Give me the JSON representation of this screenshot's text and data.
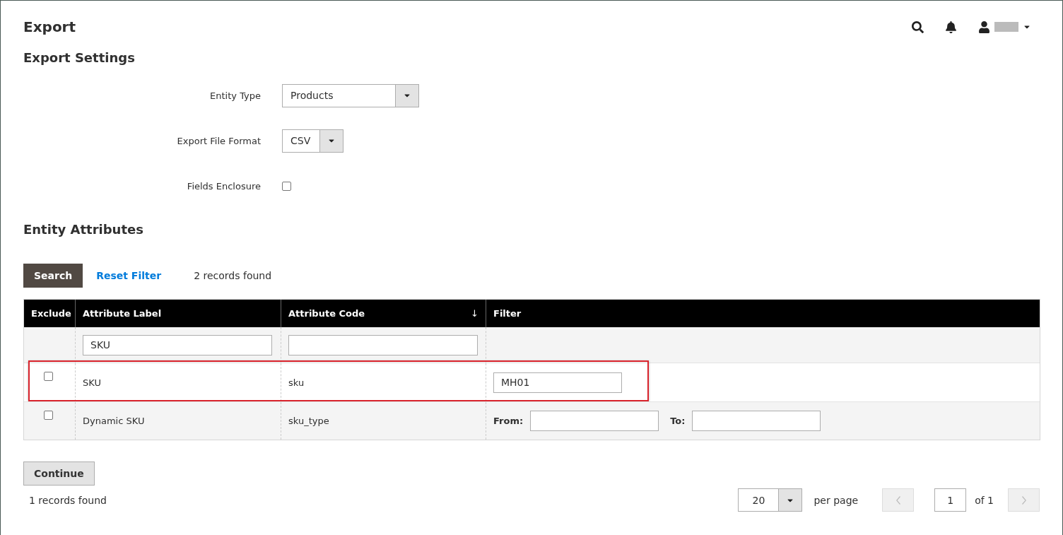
{
  "page_title": "Export",
  "section_title": "Export Settings",
  "settings": [
    {
      "kind": "select",
      "label": "Entity Type",
      "value": "Products",
      "wide": true
    },
    {
      "kind": "select",
      "label": "Export File Format",
      "value": "CSV",
      "wide": false
    },
    {
      "kind": "checkbox",
      "label": "Fields Enclosure",
      "checked": false
    }
  ],
  "attributes_title": "Entity Attributes",
  "toolbar": {
    "search": "Search",
    "reset": "Reset Filter",
    "count": "2 records found"
  },
  "columns": [
    {
      "label": "Exclude"
    },
    {
      "label": "Attribute Label"
    },
    {
      "label": "Attribute Code",
      "sort_mark": "↓"
    },
    {
      "label": "Filter"
    }
  ],
  "filters": {
    "label": "SKU"
  },
  "rows": [
    {
      "exclude": false,
      "label": "SKU",
      "code": "sku",
      "highlighted": true,
      "filter": {
        "kind": "text",
        "value": "MH01"
      }
    },
    {
      "exclude": false,
      "label": "Dynamic SKU",
      "code": "sku_type",
      "highlighted": false,
      "filter": {
        "kind": "range",
        "from_label": "From:",
        "to_label": "To:"
      }
    }
  ],
  "continue": "Continue",
  "footer": {
    "count": "1 records found",
    "per_page": "20",
    "per_page_label": "per page",
    "page": "1",
    "of": "of 1"
  }
}
